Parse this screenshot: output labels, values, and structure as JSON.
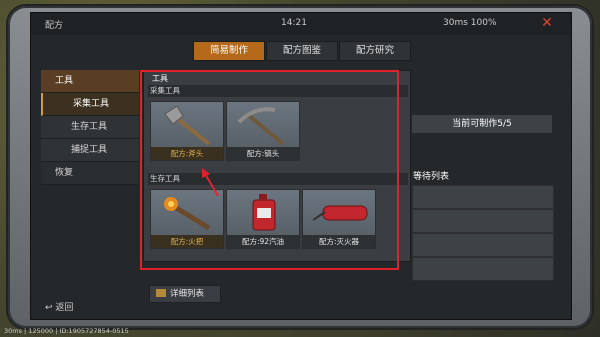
{
  "status": {
    "title": "配方",
    "clock": "14:21",
    "network": "30ms 100%"
  },
  "tabs": [
    {
      "label": "简易制作",
      "active": true
    },
    {
      "label": "配方图鉴",
      "active": false
    },
    {
      "label": "配方研究",
      "active": false
    }
  ],
  "sidebar": {
    "section_tools": "工具",
    "items": [
      {
        "label": "采集工具",
        "active": true
      },
      {
        "label": "生存工具",
        "active": false
      },
      {
        "label": "捕捉工具",
        "active": false
      }
    ],
    "section_restore": "恢复"
  },
  "panel": {
    "title": "工具",
    "groups": [
      {
        "title": "采集工具",
        "cards": [
          {
            "name": "配方:斧头",
            "icon": "axe-icon"
          },
          {
            "name": "配方:镐头",
            "icon": "pickaxe-icon"
          }
        ]
      },
      {
        "title": "生存工具",
        "cards": [
          {
            "name": "配方:火把",
            "icon": "torch-icon"
          },
          {
            "name": "配方:92汽油",
            "icon": "gas-can-icon"
          },
          {
            "name": "配方:灭火器",
            "icon": "extinguisher-icon"
          }
        ]
      }
    ],
    "detail_list": "详细列表"
  },
  "right": {
    "can_craft": "当前可制作5/5",
    "queue_title": "等待列表"
  },
  "back": "返回",
  "bottom": "30ms | 125000 | ID:1905727854-0515",
  "colors": {
    "accent": "#b56a1b",
    "highlight_border": "#e0232a"
  }
}
